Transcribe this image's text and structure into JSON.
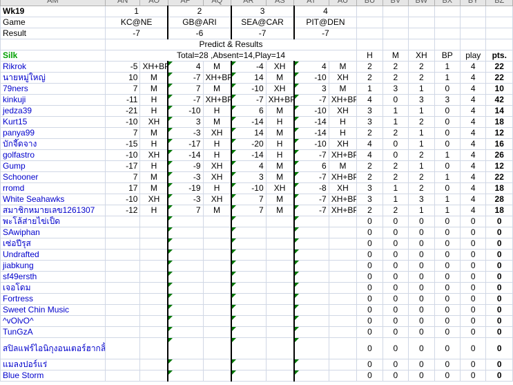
{
  "col_headers": [
    "AM",
    "AN",
    "AO",
    "AP",
    "AQ",
    "AR",
    "AS",
    "AT",
    "AU",
    "BU",
    "BV",
    "BW",
    "BX",
    "BY",
    "BZ"
  ],
  "week": "Wk19",
  "game_numbers": [
    "1",
    "2",
    "3",
    "4"
  ],
  "game_label": "Game",
  "games": [
    "KC@NE",
    "GB@ARI",
    "SEA@CAR",
    "PIT@DEN"
  ],
  "result_label": "Result",
  "results": [
    "-7",
    "-6",
    "-7",
    "-7"
  ],
  "predict_label": "Predict & Results",
  "silk_label": "Silk",
  "totals_text": "Total=28 ,Absent=14,Play=14",
  "stat_headers": [
    "H",
    "M",
    "XH",
    "BP",
    "play",
    "pts."
  ],
  "players": [
    {
      "name": "Rikrok",
      "p": [
        [
          "-5",
          "XH+BP"
        ],
        [
          "4",
          "M"
        ],
        [
          "-4",
          "XH"
        ],
        [
          "4",
          "M"
        ]
      ],
      "s": [
        "2",
        "2",
        "2",
        "1",
        "4",
        "22"
      ]
    },
    {
      "name": "นายหมู่ใหญ่",
      "p": [
        [
          "10",
          "M"
        ],
        [
          "-7",
          "XH+BP"
        ],
        [
          "14",
          "M"
        ],
        [
          "-10",
          "XH"
        ]
      ],
      "s": [
        "2",
        "2",
        "2",
        "1",
        "4",
        "22"
      ]
    },
    {
      "name": "79ners",
      "p": [
        [
          "7",
          "M"
        ],
        [
          "7",
          "M"
        ],
        [
          "-10",
          "XH"
        ],
        [
          "3",
          "M"
        ]
      ],
      "s": [
        "1",
        "3",
        "1",
        "0",
        "4",
        "10"
      ]
    },
    {
      "name": "kinkuji",
      "p": [
        [
          "-11",
          "H"
        ],
        [
          "-7",
          "XH+BP"
        ],
        [
          "-7",
          "XH+BP"
        ],
        [
          "-7",
          "XH+BP"
        ]
      ],
      "s": [
        "4",
        "0",
        "3",
        "3",
        "4",
        "42"
      ]
    },
    {
      "name": "jedza39",
      "p": [
        [
          "-21",
          "H"
        ],
        [
          "-10",
          "H"
        ],
        [
          "6",
          "M"
        ],
        [
          "-10",
          "XH"
        ]
      ],
      "s": [
        "3",
        "1",
        "1",
        "0",
        "4",
        "14"
      ]
    },
    {
      "name": "Kurt15",
      "p": [
        [
          "-10",
          "XH"
        ],
        [
          "3",
          "M"
        ],
        [
          "-14",
          "H"
        ],
        [
          "-14",
          "H"
        ]
      ],
      "s": [
        "3",
        "1",
        "2",
        "0",
        "4",
        "18"
      ]
    },
    {
      "name": "panya99",
      "p": [
        [
          "7",
          "M"
        ],
        [
          "-3",
          "XH"
        ],
        [
          "14",
          "M"
        ],
        [
          "-14",
          "H"
        ]
      ],
      "s": [
        "2",
        "2",
        "1",
        "0",
        "4",
        "12"
      ]
    },
    {
      "name": "บักจี๊ดจาง",
      "p": [
        [
          "-15",
          "H"
        ],
        [
          "-17",
          "H"
        ],
        [
          "-20",
          "H"
        ],
        [
          "-10",
          "XH"
        ]
      ],
      "s": [
        "4",
        "0",
        "1",
        "0",
        "4",
        "16"
      ]
    },
    {
      "name": "golfastro",
      "p": [
        [
          "-10",
          "XH"
        ],
        [
          "-14",
          "H"
        ],
        [
          "-14",
          "H"
        ],
        [
          "-7",
          "XH+BP"
        ]
      ],
      "s": [
        "4",
        "0",
        "2",
        "1",
        "4",
        "26"
      ]
    },
    {
      "name": "Gump",
      "p": [
        [
          "-17",
          "H"
        ],
        [
          "-9",
          "XH"
        ],
        [
          "4",
          "M"
        ],
        [
          "6",
          "M"
        ]
      ],
      "s": [
        "2",
        "2",
        "1",
        "0",
        "4",
        "12"
      ]
    },
    {
      "name": "Schooner",
      "p": [
        [
          "7",
          "M"
        ],
        [
          "-3",
          "XH"
        ],
        [
          "3",
          "M"
        ],
        [
          "-7",
          "XH+BP"
        ]
      ],
      "s": [
        "2",
        "2",
        "2",
        "1",
        "4",
        "22"
      ]
    },
    {
      "name": "rromd",
      "p": [
        [
          "17",
          "M"
        ],
        [
          "-19",
          "H"
        ],
        [
          "-10",
          "XH"
        ],
        [
          "-8",
          "XH"
        ]
      ],
      "s": [
        "3",
        "1",
        "2",
        "0",
        "4",
        "18"
      ]
    },
    {
      "name": "White Seahawks",
      "p": [
        [
          "-10",
          "XH"
        ],
        [
          "-3",
          "XH"
        ],
        [
          "7",
          "M"
        ],
        [
          "-7",
          "XH+BP"
        ]
      ],
      "s": [
        "3",
        "1",
        "3",
        "1",
        "4",
        "28"
      ]
    },
    {
      "name": "สมาชิกหมายเลข1261307",
      "p": [
        [
          "-12",
          "H"
        ],
        [
          "7",
          "M"
        ],
        [
          "7",
          "M"
        ],
        [
          "-7",
          "XH+BP"
        ]
      ],
      "s": [
        "2",
        "2",
        "1",
        "1",
        "4",
        "18"
      ]
    },
    {
      "name": "พะโล้ส่ายไข่เป็ด",
      "p": [],
      "s": [
        "0",
        "0",
        "0",
        "0",
        "0",
        "0"
      ]
    },
    {
      "name": "SAwiphan",
      "p": [],
      "s": [
        "0",
        "0",
        "0",
        "0",
        "0",
        "0"
      ]
    },
    {
      "name": "เซ่อปีรุส",
      "p": [],
      "s": [
        "0",
        "0",
        "0",
        "0",
        "0",
        "0"
      ]
    },
    {
      "name": "Undrafted",
      "p": [],
      "s": [
        "0",
        "0",
        "0",
        "0",
        "0",
        "0"
      ]
    },
    {
      "name": "jiabkung",
      "p": [],
      "s": [
        "0",
        "0",
        "0",
        "0",
        "0",
        "0"
      ]
    },
    {
      "name": "sf49ersth",
      "p": [],
      "s": [
        "0",
        "0",
        "0",
        "0",
        "0",
        "0"
      ]
    },
    {
      "name": "เจอโดม",
      "p": [],
      "s": [
        "0",
        "0",
        "0",
        "0",
        "0",
        "0"
      ]
    },
    {
      "name": "Fortress",
      "p": [],
      "s": [
        "0",
        "0",
        "0",
        "0",
        "0",
        "0"
      ]
    },
    {
      "name": "Sweet Chin Music",
      "p": [],
      "s": [
        "0",
        "0",
        "0",
        "0",
        "0",
        "0"
      ]
    },
    {
      "name": "^vOlvO^",
      "p": [],
      "s": [
        "0",
        "0",
        "0",
        "0",
        "0",
        "0"
      ]
    },
    {
      "name": "TunGzA",
      "p": [],
      "s": [
        "0",
        "0",
        "0",
        "0",
        "0",
        "0"
      ]
    },
    {
      "name": "สปิลแฟร์ไอนิกุงอนเตอร์ฮากลิ้ง",
      "p": [],
      "s": [
        "0",
        "0",
        "0",
        "0",
        "0",
        "0"
      ],
      "tall": true
    },
    {
      "name": "แมลงปอร์แร่",
      "p": [],
      "s": [
        "0",
        "0",
        "0",
        "0",
        "0",
        "0"
      ]
    },
    {
      "name": "Blue Storm",
      "p": [],
      "s": [
        "0",
        "0",
        "0",
        "0",
        "0",
        "0"
      ]
    }
  ]
}
